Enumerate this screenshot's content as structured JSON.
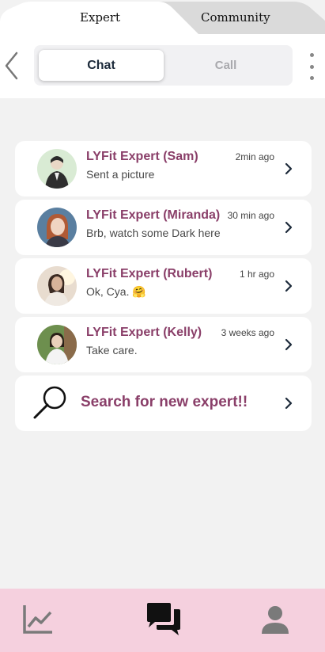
{
  "top_tabs": {
    "expert": "Expert",
    "community": "Community"
  },
  "header": {
    "chat_label": "Chat",
    "call_label": "Call"
  },
  "chats": [
    {
      "name": "LYFit Expert (Sam)",
      "message": "Sent a picture",
      "time": "2min ago"
    },
    {
      "name": "LYFit Expert (Miranda)",
      "message": "Brb, watch some Dark here",
      "time": "30 min ago"
    },
    {
      "name": "LYFit Expert (Rubert)",
      "message": "Ok, Cya. 🤗",
      "time": "1 hr ago"
    },
    {
      "name": "LYFit Expert (Kelly)",
      "message": "Take care.",
      "time": "3 weeks ago"
    }
  ],
  "search": {
    "label": "Search for new expert!!"
  },
  "bottom_nav": {
    "items": [
      "progress-chart-icon",
      "chat-bubbles-icon",
      "profile-icon"
    ]
  },
  "colors": {
    "accent": "#8a3f69",
    "nav_bg": "#f5d0de",
    "page_bg": "#f2f2f2"
  }
}
